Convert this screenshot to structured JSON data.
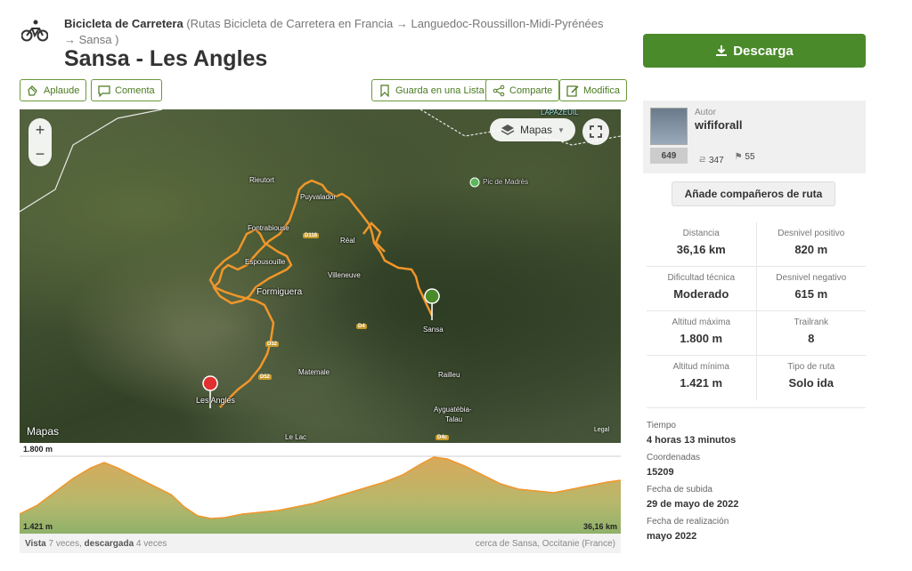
{
  "breadcrumb": {
    "activity": "Bicicleta de Carretera",
    "path": "(Rutas Bicicleta de Carretera en Francia → Languedoc-Roussillon-Midi-Pyrénées → Sansa )"
  },
  "title": "Sansa - Les Angles",
  "actions": {
    "applaud": "Aplaude",
    "comment": "Comenta",
    "save_list": "Guarda en una Lista",
    "share": "Comparte",
    "edit": "Modifica"
  },
  "map": {
    "layer_button": "Mapas",
    "attribution": "Mapas",
    "legal": "Legal",
    "places": {
      "lapazeuil": "LAPAZEUIL",
      "rieutort": "Rieutort",
      "puyvalador": "Puyvalador",
      "pic": "Pic de Madrès",
      "fontrabiouse": "Fontrabiouse",
      "real": "Réal",
      "espousouille": "Espousouille",
      "villeneuve": "Villeneuve",
      "formiguera": "Formiguera",
      "sansa": "Sansa",
      "matemale": "Matemale",
      "railleu": "Railleu",
      "les_angles": "Les Angles",
      "ayguatebia": "Ayguatébia-",
      "talau": "Talau",
      "le_lac": "Le Lac"
    },
    "roads": {
      "d118": "D118",
      "d4": "D4",
      "d32": "D32",
      "d52": "D52",
      "d4c": "D4c"
    }
  },
  "elevation": {
    "max_label": "1.800 m",
    "min_label": "1.421 m",
    "dist_label": "36,16 km"
  },
  "footer": {
    "views_label": "Vista",
    "views_value": "7 veces,",
    "downloads_label": "descargada",
    "downloads_value": "4 veces",
    "location": "cerca de Sansa, Occitanie (France)"
  },
  "download_button": "Descarga",
  "author": {
    "label": "Autor",
    "name": "wififorall",
    "rank": "649",
    "trails": "347",
    "followers": "55"
  },
  "mates_button": "Añade compañeros de ruta",
  "stats": [
    {
      "label": "Distancia",
      "value": "36,16 km"
    },
    {
      "label": "Desnivel positivo",
      "value": "820 m"
    },
    {
      "label": "Dificultad técnica",
      "value": "Moderado"
    },
    {
      "label": "Desnivel negativo",
      "value": "615 m"
    },
    {
      "label": "Altitud máxima",
      "value": "1.800 m"
    },
    {
      "label": "Trailrank",
      "value": "8"
    },
    {
      "label": "Altitud mínima",
      "value": "1.421 m"
    },
    {
      "label": "Tipo de ruta",
      "value": "Solo ida"
    }
  ],
  "info": [
    {
      "label": "Tiempo",
      "value": "4 horas 13 minutos"
    },
    {
      "label": "Coordenadas",
      "value": "15209"
    },
    {
      "label": "Fecha de subida",
      "value": "29 de mayo de 2022"
    },
    {
      "label": "Fecha de realización",
      "value": "mayo 2022"
    }
  ],
  "colors": {
    "brand": "#4a8a2a",
    "route": "#f0962a",
    "profile_fill": "#c8b468"
  }
}
